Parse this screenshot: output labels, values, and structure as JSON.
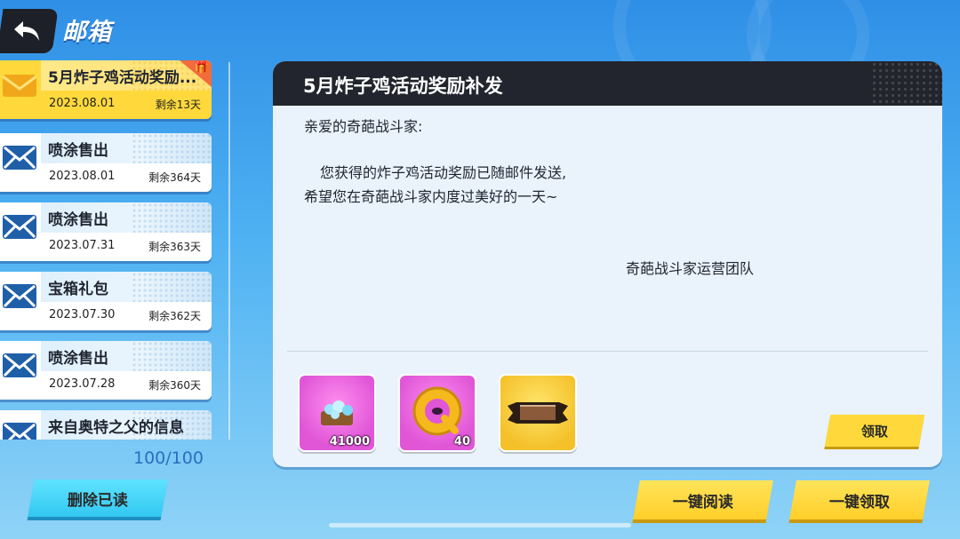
{
  "header": {
    "title": "邮箱",
    "back_icon": "back-arrow-icon"
  },
  "mails": [
    {
      "title": "5月炸子鸡活动奖励...",
      "date": "2023.08.01",
      "remaining": "剩余13天",
      "selected": true,
      "has_gift": true
    },
    {
      "title": "喷涂售出",
      "date": "2023.08.01",
      "remaining": "剩余364天"
    },
    {
      "title": "喷涂售出",
      "date": "2023.07.31",
      "remaining": "剩余363天"
    },
    {
      "title": "宝箱礼包",
      "date": "2023.07.30",
      "remaining": "剩余362天"
    },
    {
      "title": "喷涂售出",
      "date": "2023.07.28",
      "remaining": "剩余360天"
    },
    {
      "title": "来自奥特之父的信息",
      "date": "",
      "remaining": ""
    }
  ],
  "mail_count": "100/100",
  "detail": {
    "title": "5月炸子鸡活动奖励补发",
    "greeting": "亲爱的奇葩战斗家:",
    "body_line1": "您获得的炸子鸡活动奖励已随邮件发送,",
    "body_line2": "希望您在奇葩战斗家内度过美好的一天~",
    "signature": "奇葩战斗家运营团队",
    "rewards": [
      {
        "icon": "gem-pile-icon",
        "qty": "41000"
      },
      {
        "icon": "q-coin-icon",
        "qty": "40"
      },
      {
        "icon": "banner-frame-icon",
        "qty": ""
      }
    ],
    "claim_label": "领取"
  },
  "buttons": {
    "delete_read": "删除已读",
    "read_all": "一键阅读",
    "claim_all": "一键领取"
  },
  "colors": {
    "accent_yellow": "#ffd93b",
    "panel_dark": "#22252d",
    "cyan": "#32c8f1"
  }
}
